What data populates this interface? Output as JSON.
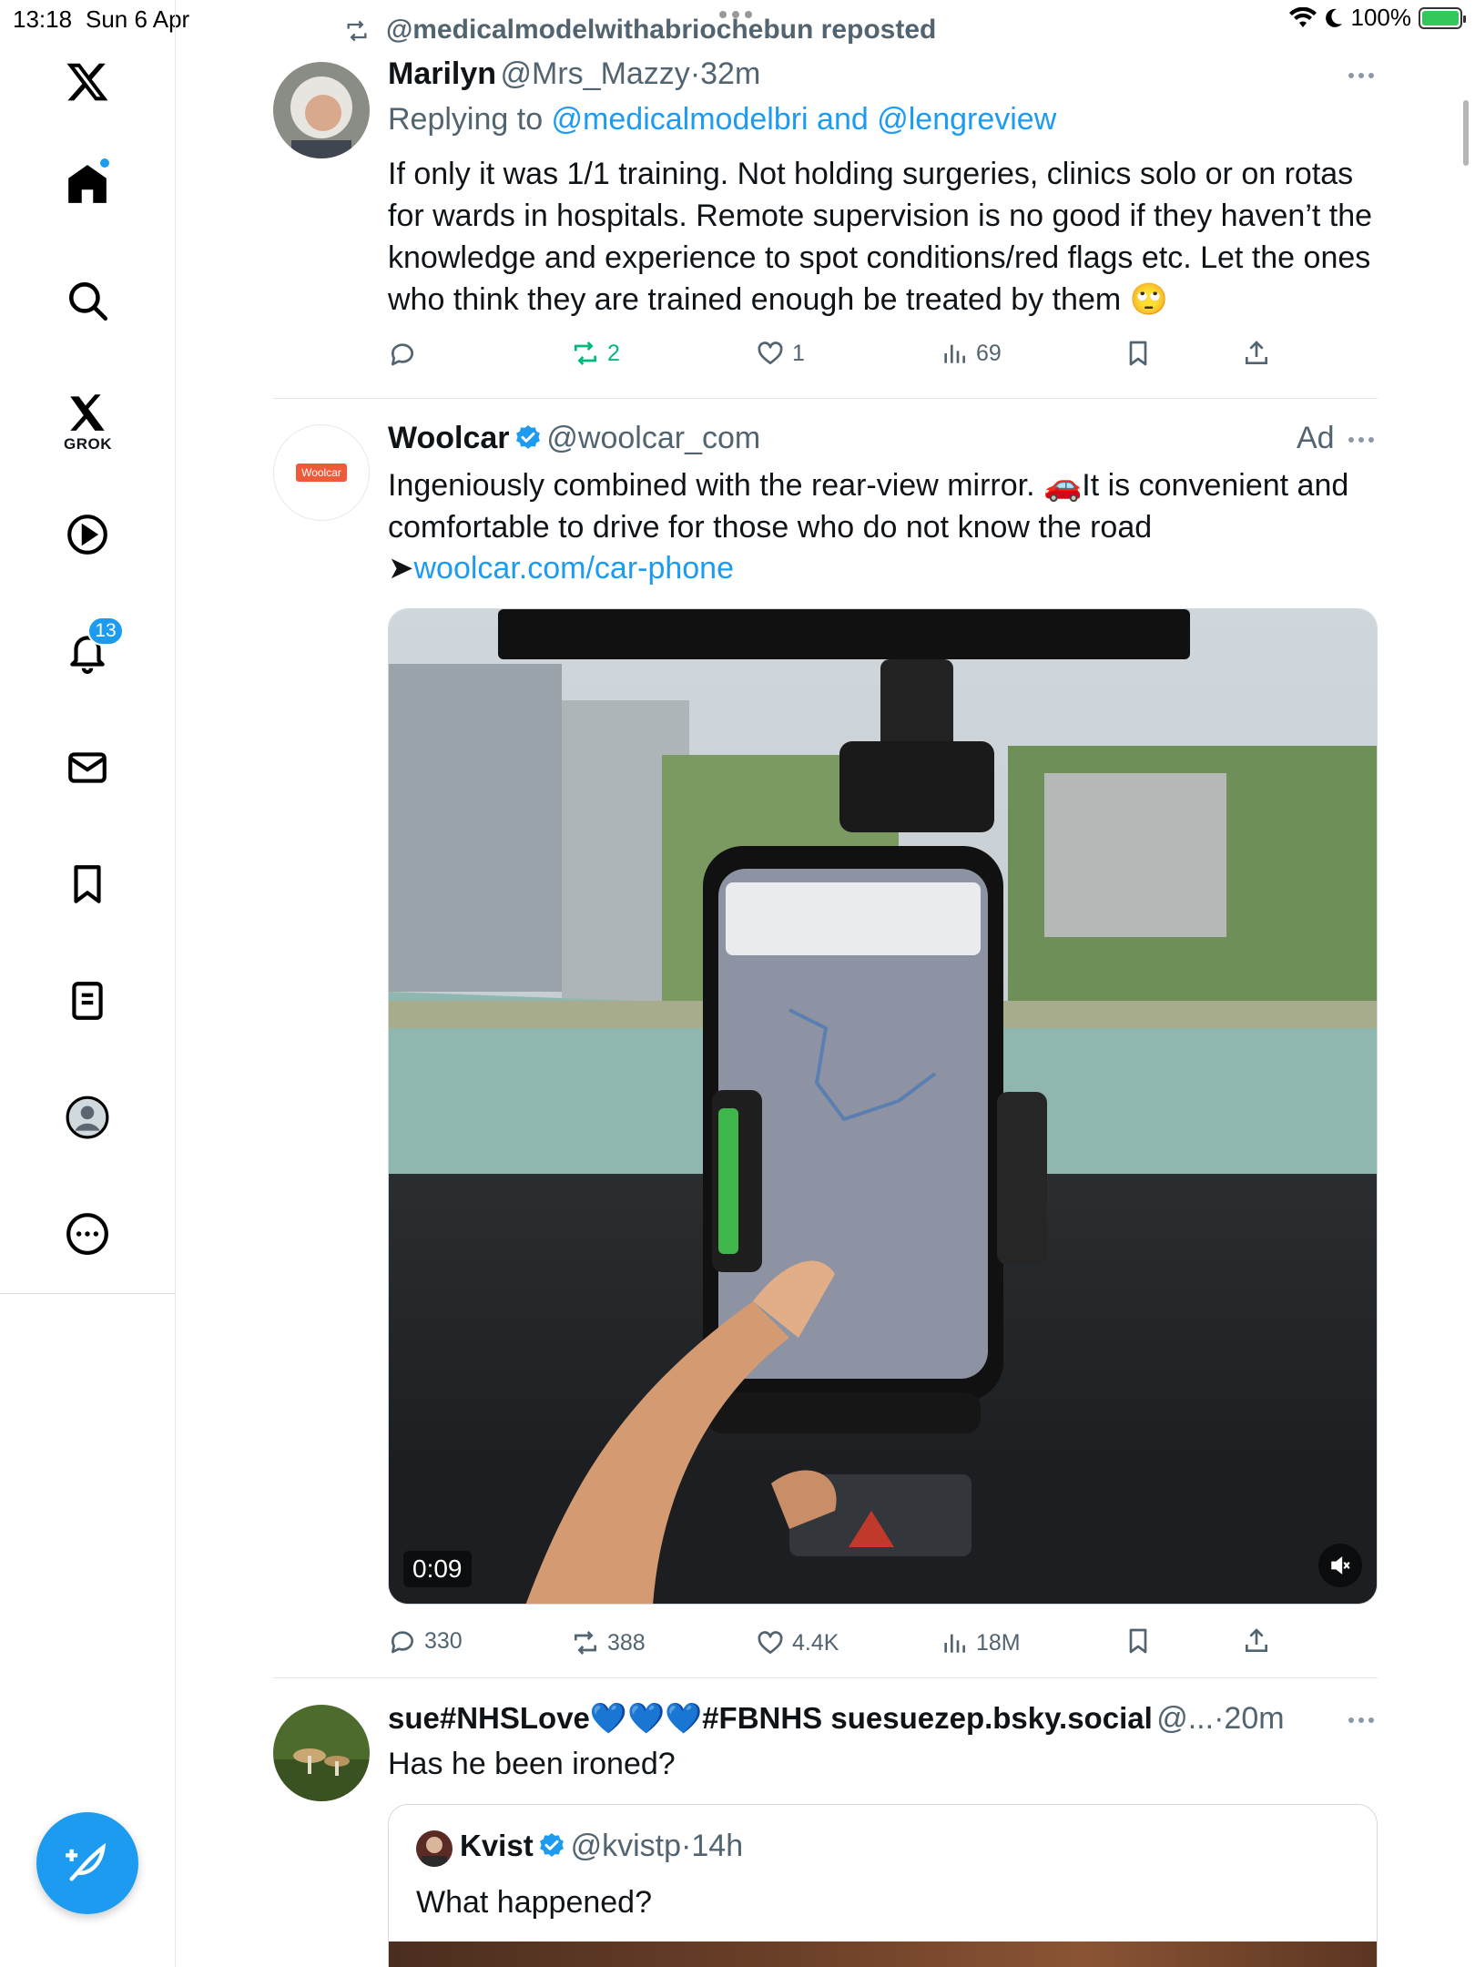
{
  "status_bar": {
    "time": "13:18",
    "date": "Sun 6 Apr",
    "battery": "100%"
  },
  "sidebar": {
    "grok_label": "GROK",
    "notifications_count": "13"
  },
  "tweet1": {
    "repost_label": "@medicalmodelwithabriochebun reposted",
    "name": "Marilyn",
    "handle": "@Mrs_Mazzy",
    "time": "32m",
    "replying_prefix": "Replying to ",
    "replying_to": "@medicalmodelbri and @lengreview",
    "text": "If only it was 1/1 training. Not holding surgeries, clinics solo or on rotas for wards in hospitals. Remote supervision is no good if they haven’t the knowledge and experience to spot conditions/red flags etc. Let the ones who think they are trained enough be treated by them 🙄",
    "replies": "",
    "reposts": "2",
    "likes": "1",
    "views": "69"
  },
  "tweet2": {
    "name": "Woolcar",
    "handle": "@woolcar_com",
    "ad_label": "Ad",
    "avatar_text": "Woolcar",
    "text": "Ingeniously combined with the rear-view mirror. 🚗It is convenient and comfortable to drive for those who do not know the road",
    "link_prefix": "➤",
    "link": "woolcar.com/car-phone",
    "video_duration": "0:09",
    "replies": "330",
    "reposts": "388",
    "likes": "4.4K",
    "views": "18M"
  },
  "tweet3": {
    "name": "sue#NHSLove💙💙💙#FBNHS suesuezep.bsky.social",
    "handle": "@...",
    "time": "20m",
    "text": "Has he been ironed?",
    "quote": {
      "name": "Kvist",
      "handle": "@kvistp",
      "time": "14h",
      "text": "What happened?"
    }
  },
  "colors": {
    "accent": "#1d9bf0",
    "repost_green": "#00ba7c",
    "text": "#0f1419",
    "muted": "#536471"
  }
}
